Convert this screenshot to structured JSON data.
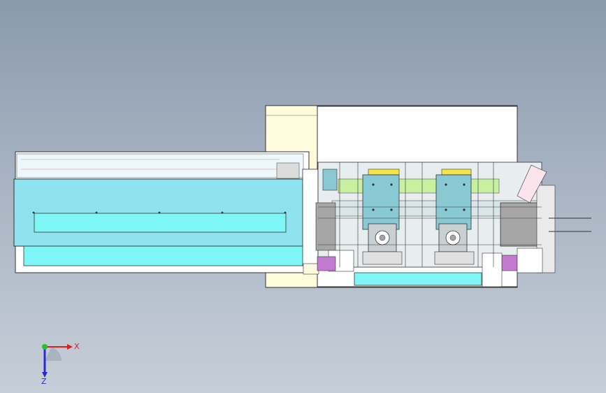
{
  "viewport": {
    "background_top": "#8a9aad",
    "background_bottom": "#c6ced8"
  },
  "colors": {
    "light_cyan": "#7ff6f6",
    "cyan_panel": "#8fe3ef",
    "cream": "#fffbdc",
    "white": "#ffffff",
    "yellow": "#f3e54a",
    "magenta": "#c47ad0",
    "grey_plate": "#a6a6a6",
    "dark_line": "#333333",
    "lime": "#c7f0a0",
    "teal_block": "#89c9d4"
  },
  "triad": {
    "x_label": "X",
    "z_label": "Z",
    "x_color": "#d62020",
    "z_color": "#2a2ad0",
    "origin_color": "#28c028"
  },
  "icons": {
    "triad": "coordinate-triad-icon"
  }
}
